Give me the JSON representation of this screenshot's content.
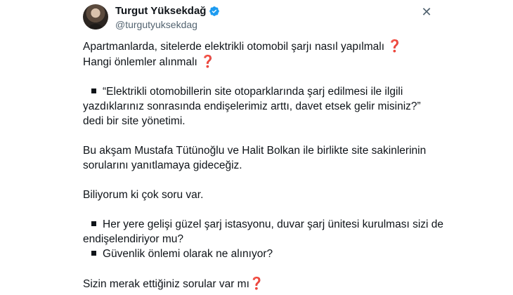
{
  "author": {
    "display_name": "Turgut Yüksekdağ",
    "handle": "@turgutyuksekdag",
    "verified_color": "#1d9bf0"
  },
  "header_icons": {
    "more": "close-icon"
  },
  "tweet": {
    "line1": "Apartmanlarda, sitelerde elektrikli otomobil şarjı nasıl yapılmalı",
    "line2": "Hangi önlemler alınmalı",
    "quote_line1": "“Elektrikli otomobillerin site otoparklarında şarj edilmesi ile ilgili",
    "quote_line2": "yazdıklarınız sonrasında endişelerimiz arttı, davet etsek gelir misiniz?”",
    "quote_line3": "dedi bir site yönetimi.",
    "para_line1": "Bu akşam Mustafa Tütünoğlu ve Halit Bolkan ile birlikte site sakinlerinin",
    "para_line2": "sorularını yanıtlamaya gideceğiz.",
    "know_line": "Biliyorum ki çok soru var.",
    "bullet1_line1": "Her yere gelişi güzel şarj istasyonu, duvar şarj ünitesi kurulması sizi de",
    "bullet1_line2": "endişelendiriyor mu?",
    "bullet2": "Güvenlik önlemi olarak ne alınıyor?",
    "last_line": "Sizin merak ettiğiniz sorular var mı",
    "question_mark": "❓"
  },
  "colors": {
    "text": "#0f1419",
    "secondary": "#536471",
    "question": "#dd2e44"
  }
}
